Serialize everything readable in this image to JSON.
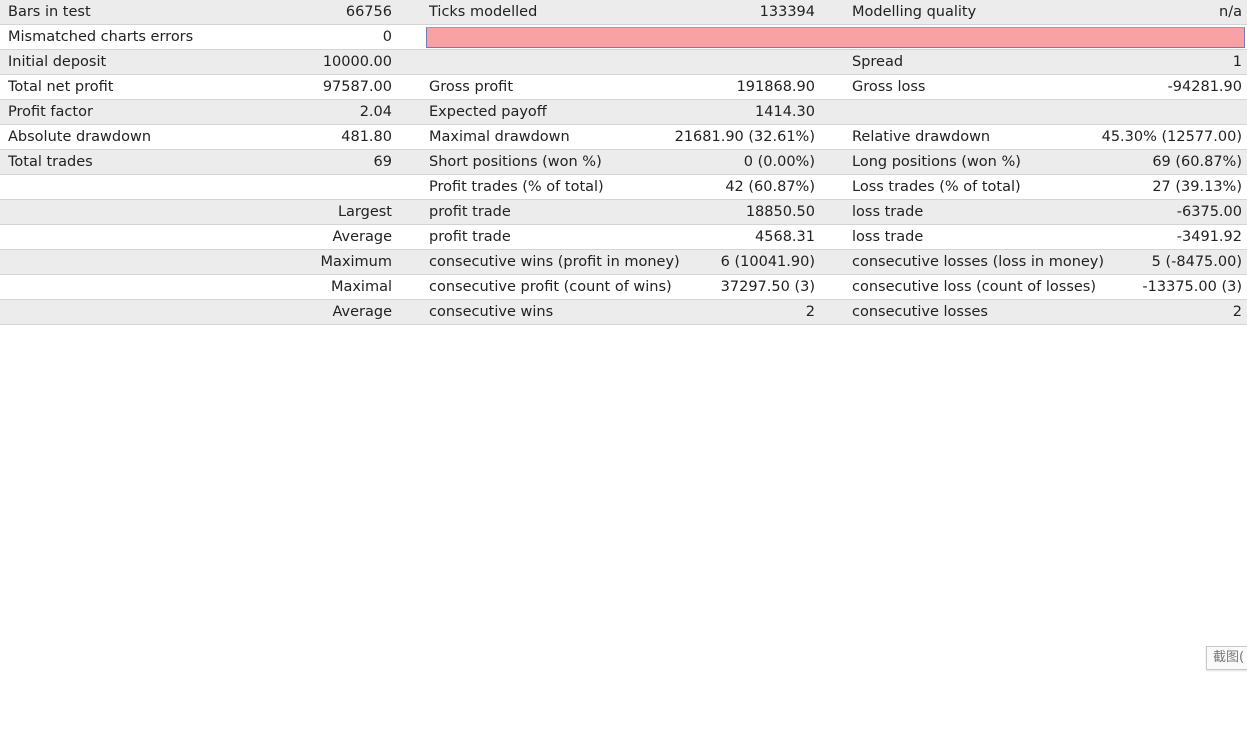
{
  "report": {
    "r1": {
      "c1": "Bars in test",
      "c2": "66756",
      "c3": "Ticks modelled",
      "c4": "133394",
      "c5": "Modelling quality",
      "c6": "n/a"
    },
    "r2": {
      "c1": "Mismatched charts errors",
      "c2": "0"
    },
    "r3": {
      "c1": "Initial deposit",
      "c2": "10000.00",
      "c5": "Spread",
      "c6": "1"
    },
    "r4": {
      "c1": "Total net profit",
      "c2": "97587.00",
      "c3": "Gross profit",
      "c4": "191868.90",
      "c5": "Gross loss",
      "c6": "-94281.90"
    },
    "r5": {
      "c1": "Profit factor",
      "c2": "2.04",
      "c3": "Expected payoff",
      "c4": "1414.30"
    },
    "r6": {
      "c1": "Absolute drawdown",
      "c2": "481.80",
      "c3": "Maximal drawdown",
      "c4": "21681.90 (32.61%)",
      "c5": "Relative drawdown",
      "c6": "45.30% (12577.00)"
    },
    "r7": {
      "c1": "Total trades",
      "c2": "69",
      "c3": "Short positions (won %)",
      "c4": "0 (0.00%)",
      "c5": "Long positions (won %)",
      "c6": "69 (60.87%)"
    },
    "r8": {
      "c3": "Profit trades (% of total)",
      "c4": "42 (60.87%)",
      "c5": "Loss trades (% of total)",
      "c6": "27 (39.13%)"
    },
    "r9": {
      "c2": "Largest",
      "c3": "profit trade",
      "c4": "18850.50",
      "c5": "loss trade",
      "c6": "-6375.00"
    },
    "r10": {
      "c2": "Average",
      "c3": "profit trade",
      "c4": "4568.31",
      "c5": "loss trade",
      "c6": "-3491.92"
    },
    "r11": {
      "c2": "Maximum",
      "c3": "consecutive wins (profit in money)",
      "c4": "6 (10041.90)",
      "c5": "consecutive losses (loss in money)",
      "c6": "5 (-8475.00)"
    },
    "r12": {
      "c2": "Maximal",
      "c3": "consecutive profit (count of wins)",
      "c4": "37297.50 (3)",
      "c5": "consecutive loss (count of losses)",
      "c6": "-13375.00 (3)"
    },
    "r13": {
      "c2": "Average",
      "c3": "consecutive wins",
      "c4": "2",
      "c5": "consecutive losses",
      "c6": "2"
    }
  },
  "colors": {
    "mismatch_bar": "#f9a1a4",
    "row_shade": "#ececec"
  },
  "screenshot_tab": {
    "label": "截图("
  }
}
